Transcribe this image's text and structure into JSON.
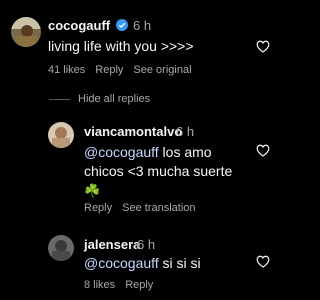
{
  "colors": {
    "background": "#000000",
    "text": "#f5f5f5",
    "muted": "#a8a8a8",
    "mention": "#c7d7ff",
    "verified": "#3897f0"
  },
  "comments": [
    {
      "username": "cocogauff",
      "verified": true,
      "time": "6 h",
      "text": "living life with you >>>>",
      "likes": "41 likes",
      "reply": "Reply",
      "extra": "See original",
      "icon": "heart-outline-icon"
    }
  ],
  "hide_replies": "Hide all replies",
  "replies": [
    {
      "username": "viancamontalvo",
      "time": "6 h",
      "mention": "@cocogauff",
      "text_line1": " los amo",
      "text_line2": "chicos <3 mucha suerte",
      "emoji": "☘️",
      "reply": "Reply",
      "extra": "See translation",
      "icon": "heart-outline-icon"
    },
    {
      "username": "jalensera",
      "time": "6 h",
      "mention": "@cocogauff",
      "text": " si si si",
      "likes": "8 likes",
      "reply": "Reply",
      "icon": "heart-outline-icon"
    }
  ]
}
